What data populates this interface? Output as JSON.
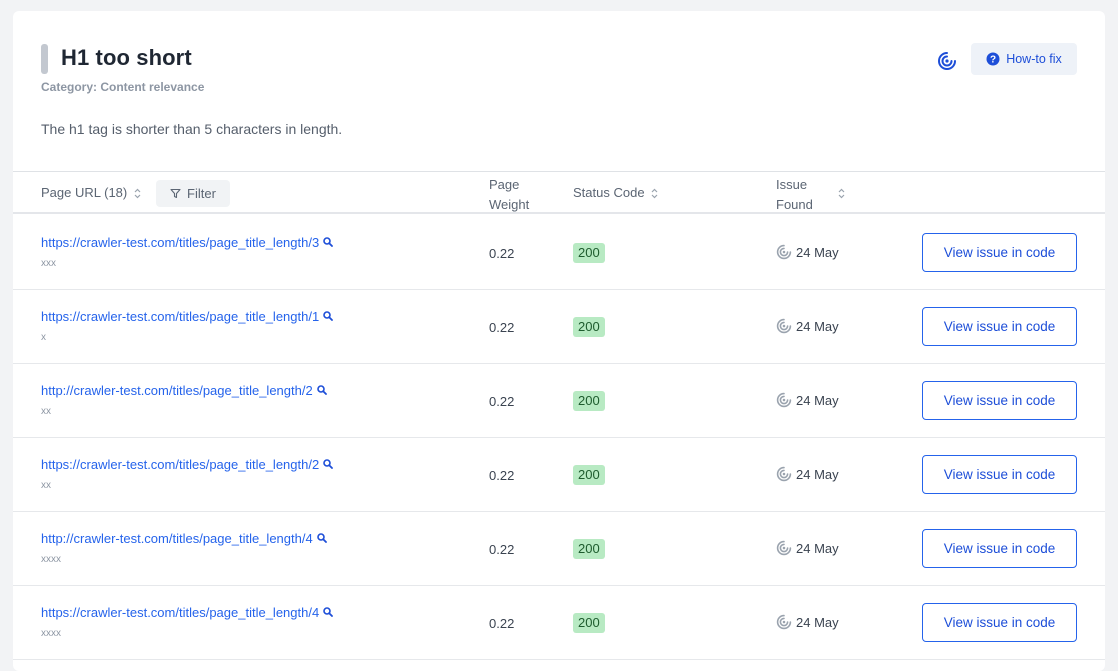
{
  "issue": {
    "title": "H1 too short",
    "category": "Category: Content relevance",
    "description": "The h1 tag is shorter than 5 characters in length.",
    "howto_label": "How-to fix"
  },
  "table": {
    "col_url": "Page URL (18)",
    "filter_label": "Filter",
    "col_weight_1": "Page",
    "col_weight_2": "Weight",
    "col_status": "Status Code",
    "col_found_1": "Issue",
    "col_found_2": "Found",
    "rows": [
      {
        "url": "https://crawler-test.com/titles/page_title_length/3",
        "h1": "xxx",
        "weight": "0.22",
        "status": "200",
        "found": "24 May",
        "action": "View issue in code"
      },
      {
        "url": "https://crawler-test.com/titles/page_title_length/1",
        "h1": "x",
        "weight": "0.22",
        "status": "200",
        "found": "24 May",
        "action": "View issue in code"
      },
      {
        "url": "http://crawler-test.com/titles/page_title_length/2",
        "h1": "xx",
        "weight": "0.22",
        "status": "200",
        "found": "24 May",
        "action": "View issue in code"
      },
      {
        "url": "https://crawler-test.com/titles/page_title_length/2",
        "h1": "xx",
        "weight": "0.22",
        "status": "200",
        "found": "24 May",
        "action": "View issue in code"
      },
      {
        "url": "http://crawler-test.com/titles/page_title_length/4",
        "h1": "xxxx",
        "weight": "0.22",
        "status": "200",
        "found": "24 May",
        "action": "View issue in code"
      },
      {
        "url": "https://crawler-test.com/titles/page_title_length/4",
        "h1": "xxxx",
        "weight": "0.22",
        "status": "200",
        "found": "24 May",
        "action": "View issue in code"
      }
    ]
  },
  "colors": {
    "accent": "#2563eb",
    "status_ok": "#b8eac3"
  }
}
